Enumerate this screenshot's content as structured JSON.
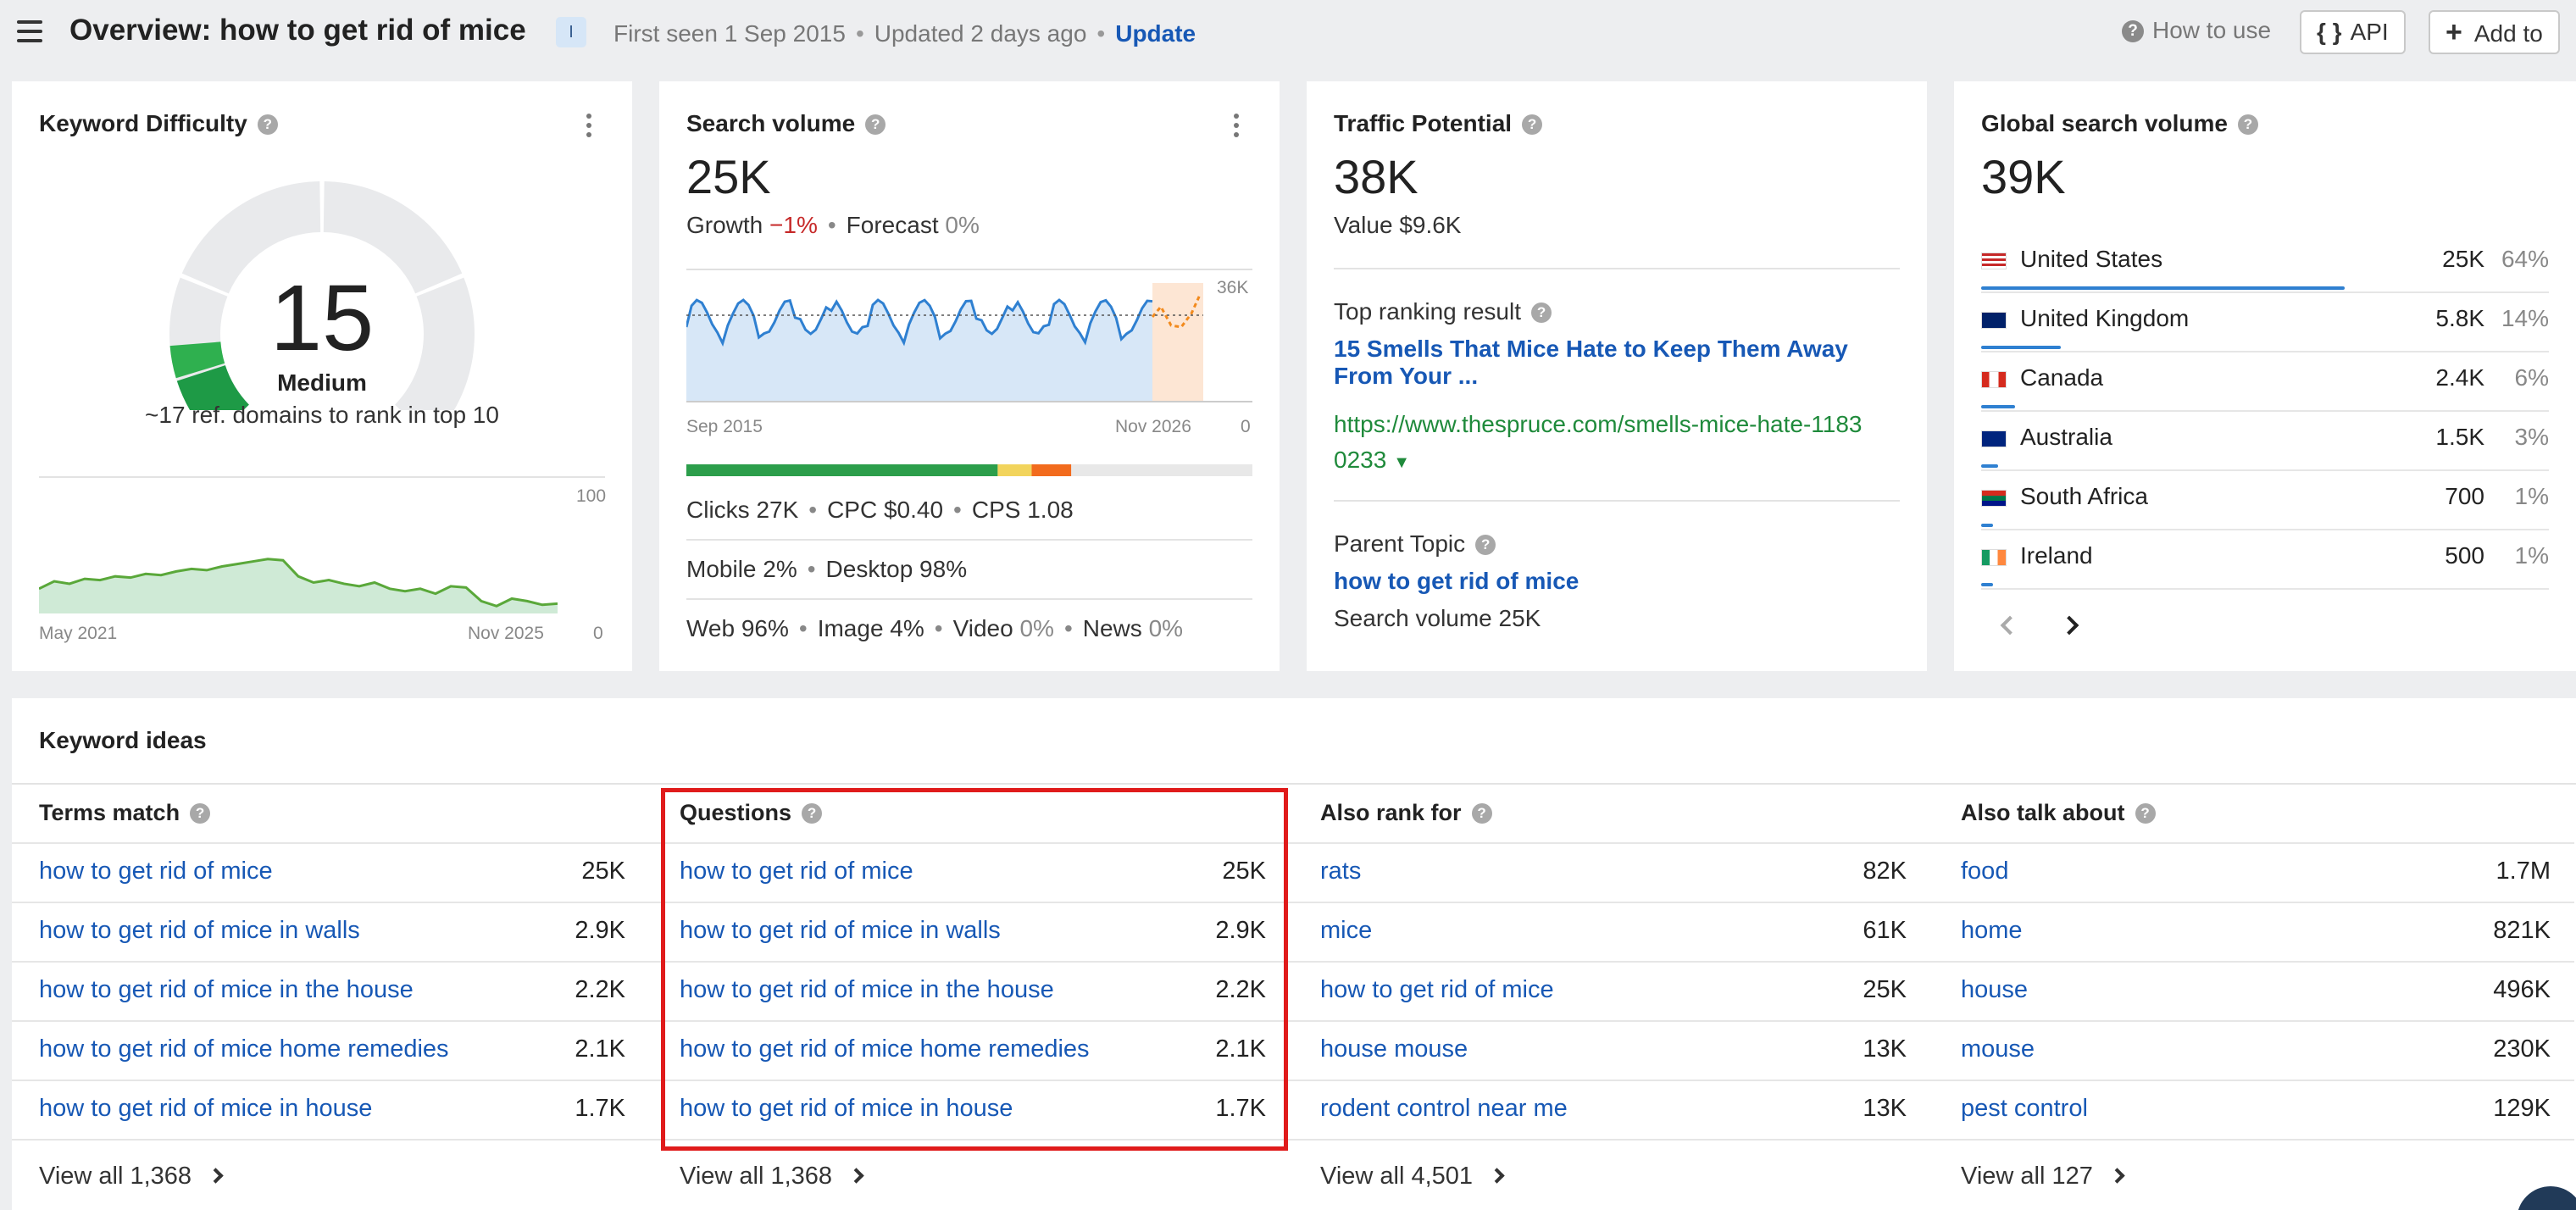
{
  "header": {
    "title": "Overview: how to get rid of mice",
    "intent_badge": "I",
    "first_seen": "First seen 1 Sep 2015",
    "updated": "Updated 2 days ago",
    "update_label": "Update",
    "how_to_use": "How to use",
    "api_label": "API",
    "add_to_label": "Add to",
    "api_glyph": "{ }",
    "add_glyph": "+"
  },
  "keyword_difficulty": {
    "title": "Keyword Difficulty",
    "value": "15",
    "value_num": 15,
    "level": "Medium",
    "note": "~17 ref. domains to rank in top 10",
    "chart_max": "100",
    "chart_min": "0",
    "x_start": "May 2021",
    "x_end": "Nov 2025",
    "trend": [
      20,
      26,
      24,
      28,
      27,
      30,
      29,
      32,
      31,
      34,
      36,
      35,
      38,
      40,
      42,
      44,
      43,
      30,
      25,
      27,
      24,
      22,
      25,
      20,
      18,
      20,
      16,
      22,
      21,
      10,
      6,
      12,
      10,
      7,
      8
    ]
  },
  "search_volume": {
    "title": "Search volume",
    "value": "25K",
    "growth_label": "Growth",
    "growth_value": "−1%",
    "forecast_label": "Forecast",
    "forecast_value": "0%",
    "chart_max": "36K",
    "chart_min": "0",
    "x_start": "Sep 2015",
    "x_end": "Nov 2026",
    "clicks": "Clicks 27K",
    "cpc": "CPC $0.40",
    "cps": "CPS 1.08",
    "mobile": "Mobile 2%",
    "desktop": "Desktop 98%",
    "web": "Web 96%",
    "image": "Image 4%",
    "video_label": "Video",
    "video_value": "0%",
    "news_label": "News",
    "news_value": "0%",
    "click_split": {
      "organic": 0.55,
      "paid_yellow": 0.06,
      "paid_orange": 0.07
    },
    "colors": {
      "organic": "#2c9e4b",
      "yellow": "#f2d45c",
      "orange": "#f26b1d",
      "rest": "#e8e8e8"
    }
  },
  "traffic_potential": {
    "title": "Traffic Potential",
    "value": "38K",
    "value_label": "Value $9.6K",
    "top_ranking_label": "Top ranking result",
    "top_ranking_title_1": "15 Smells That Mice Hate to Keep Them Away",
    "top_ranking_title_2": "From Your ...",
    "top_ranking_url_1": "https://www.thespruce.com/smells-mice-hate-1183",
    "top_ranking_url_2": "0233",
    "parent_topic_label": "Parent Topic",
    "parent_topic": "how to get rid of mice",
    "parent_volume": "Search volume 25K"
  },
  "global_volume": {
    "title": "Global search volume",
    "value": "39K",
    "countries": [
      {
        "name": "United States",
        "volume": "25K",
        "share": "64%",
        "frac": 0.64
      },
      {
        "name": "United Kingdom",
        "volume": "5.8K",
        "share": "14%",
        "frac": 0.14
      },
      {
        "name": "Canada",
        "volume": "2.4K",
        "share": "6%",
        "frac": 0.06
      },
      {
        "name": "Australia",
        "volume": "1.5K",
        "share": "3%",
        "frac": 0.03
      },
      {
        "name": "South Africa",
        "volume": "700",
        "share": "1%",
        "frac": 0.01
      },
      {
        "name": "Ireland",
        "volume": "500",
        "share": "1%",
        "frac": 0.01
      }
    ]
  },
  "keyword_ideas": {
    "title": "Keyword ideas",
    "columns": [
      {
        "header": "Terms match",
        "view_all": "View all 1,368",
        "rows": [
          [
            "how to get rid of mice",
            "25K"
          ],
          [
            "how to get rid of mice in walls",
            "2.9K"
          ],
          [
            "how to get rid of mice in the house",
            "2.2K"
          ],
          [
            "how to get rid of mice home remedies",
            "2.1K"
          ],
          [
            "how to get rid of mice in house",
            "1.7K"
          ]
        ]
      },
      {
        "header": "Questions",
        "view_all": "View all 1,368",
        "rows": [
          [
            "how to get rid of mice",
            "25K"
          ],
          [
            "how to get rid of mice in walls",
            "2.9K"
          ],
          [
            "how to get rid of mice in the house",
            "2.2K"
          ],
          [
            "how to get rid of mice home remedies",
            "2.1K"
          ],
          [
            "how to get rid of mice in house",
            "1.7K"
          ]
        ]
      },
      {
        "header": "Also rank for",
        "view_all": "View all 4,501",
        "rows": [
          [
            "rats",
            "82K"
          ],
          [
            "mice",
            "61K"
          ],
          [
            "how to get rid of mice",
            "25K"
          ],
          [
            "house mouse",
            "13K"
          ],
          [
            "rodent control near me",
            "13K"
          ]
        ]
      },
      {
        "header": "Also talk about",
        "view_all": "View all 127",
        "rows": [
          [
            "food",
            "1.7M"
          ],
          [
            "home",
            "821K"
          ],
          [
            "house",
            "496K"
          ],
          [
            "mouse",
            "230K"
          ],
          [
            "pest control",
            "129K"
          ]
        ]
      }
    ]
  },
  "colors": {
    "link": "#1758b5",
    "highlight": "#e01b1b",
    "kd_green": "#2c9e4b"
  }
}
